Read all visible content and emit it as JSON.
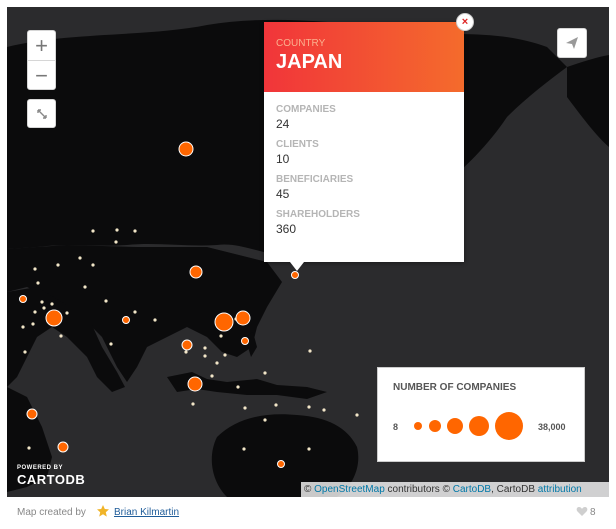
{
  "map": {
    "zoom_in_label": "+",
    "zoom_out_label": "−",
    "land_color": "#0b0b0c",
    "sea_color": "#2b2b2d",
    "marker_color": "#ff6600",
    "small_marker_color": "#f2e6c8"
  },
  "popup": {
    "header_label": "COUNTRY",
    "header_value": "JAPAN",
    "close_label": "×",
    "fields": [
      {
        "label": "COMPANIES",
        "value": "24"
      },
      {
        "label": "CLIENTS",
        "value": "10"
      },
      {
        "label": "BENEFICIARIES",
        "value": "45"
      },
      {
        "label": "SHAREHOLDERS",
        "value": "360"
      }
    ]
  },
  "legend": {
    "title": "NUMBER OF COMPANIES",
    "min": "8",
    "max": "38,000"
  },
  "branding": {
    "powered_by": "POWERED BY",
    "name": "CARTODB"
  },
  "attribution": {
    "copyright": "©",
    "osm_link": "OpenStreetMap",
    "contributors_text": "contributors ©",
    "cartodb_link": "CartoDB",
    "cartodb_text": ", CartoDB",
    "attribution_link": "attribution"
  },
  "footer": {
    "created_by": "Map created by",
    "author": "Brian Kilmartin",
    "likes": "8"
  }
}
